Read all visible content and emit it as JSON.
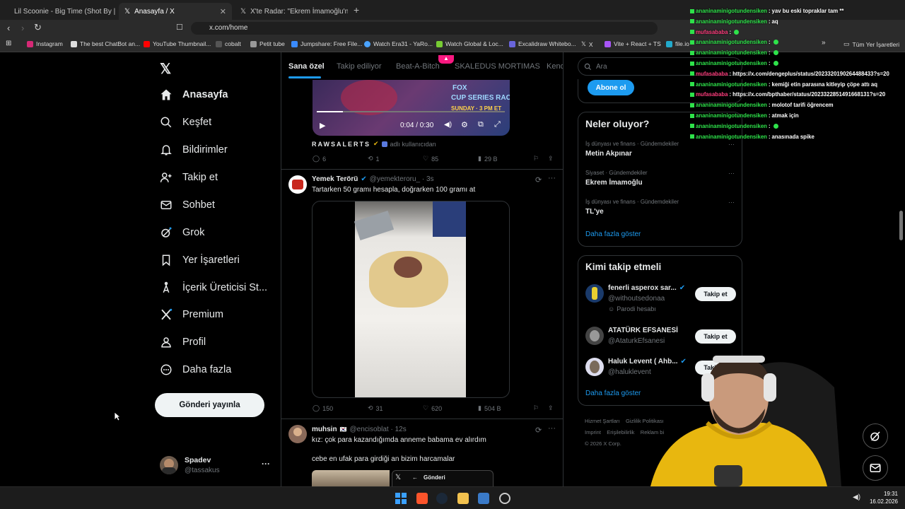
{
  "browser": {
    "tabs": [
      {
        "label": "Lil Scoonie - Big Time (Shot By | @ey"
      },
      {
        "label": "Anasayfa / X"
      },
      {
        "label": "X'te Radar: \"Ekrem İmamoğlu'nun bu"
      }
    ],
    "url": "x.com/home",
    "bookmarks": [
      "Instagram",
      "The best ChatBot an...",
      "YouTube Thumbnail...",
      "cobalt",
      "Petit tube",
      "Jumpshare: Free File...",
      "Watch Era31 - YaRo...",
      "Watch Global & Loc...",
      "Excalidraw Whitebo...",
      "X",
      "Vite + React + TS",
      "file.io",
      "Tüm Yer İşaretleri"
    ]
  },
  "nav": {
    "items": [
      "Anasayfa",
      "Keşfet",
      "Bildirimler",
      "Takip et",
      "Sohbet",
      "Grok",
      "Yer İşaretleri",
      "İçerik Üreticisi St...",
      "Premium",
      "Profil",
      "Daha fazla"
    ],
    "post_label": "Gönderi yayınla",
    "user_name": "Spadev",
    "user_handle": "@tassakus",
    "more": "···"
  },
  "feed": {
    "tabs": [
      "Sana özel",
      "Takip ediliyor",
      "Beat-A-Bitch",
      "SKALEDUS MORTIMAS",
      "Kend"
    ],
    "video": {
      "time": "0:04 / 0:30",
      "overlay1": "FOX",
      "overlay2": "CUP SERIES RACE",
      "overlay3": "SUNDAY · 3 PM ET"
    },
    "post0": {
      "author": "RAWSALERTS",
      "meta": "adlı kullanıcıdan",
      "replies": "6",
      "reposts": "1",
      "likes": "85",
      "views": "29 B"
    },
    "post1": {
      "name": "Yemek Terörü",
      "handle": "@yemekteroru_ · 3s",
      "text": "Tartarken 50 gramı hesapla, doğrarken 100 gramı at",
      "replies": "150",
      "reposts": "31",
      "likes": "620",
      "views": "504 B"
    },
    "post2": {
      "name": "muhsin",
      "handle": "@encisoblat · 12s",
      "text1": "kız: çok para kazandığımda anneme babama ev alırdım",
      "text2": "cebe en ufak para girdiği an bizim harcamalar",
      "embed_title": "Gönderi"
    }
  },
  "right": {
    "search_placeholder": "Ara",
    "subscribe": "Abone ol",
    "trends_title": "Neler oluyor?",
    "trends": [
      {
        "meta": "İş dünyası ve finans · Gündemdekiler",
        "name": "Metin Akpınar"
      },
      {
        "meta": "Siyaset · Gündemdekiler",
        "name": "Ekrem İmamoğlu"
      },
      {
        "meta": "İş dünyası ve finans · Gündemdekiler",
        "name": "TL'ye"
      }
    ],
    "show_more": "Daha fazla göster",
    "who_title": "Kimi takip etmeli",
    "who": [
      {
        "name": "fenerli asperox sar...",
        "handle": "@withoutsedonaa",
        "note": "Parodi hesabı",
        "btn": "Takip et"
      },
      {
        "name": "ATATÜRK EFSANESİ",
        "handle": "@AtaturkEfsanesi",
        "btn": "Takip et"
      },
      {
        "name": "Haluk Levent ( Ahb...",
        "handle": "@haluklevent",
        "btn": "Takip et"
      }
    ],
    "footer": [
      "Hizmet Şartları",
      "Gizlilik Politikası",
      "Imprint",
      "Erişilebilirlik",
      "Reklam bi",
      "© 2026 X Corp."
    ]
  },
  "chat": [
    {
      "user": "ananinaminigotundensiken",
      "msg": "yav bu eski topraklar tam **",
      "pink": false
    },
    {
      "user": "ananinaminigotundensiken",
      "msg": "aq",
      "pink": false
    },
    {
      "user": "mufasababa",
      "msg": "",
      "pink": true
    },
    {
      "user": "ananinaminigotundensiken",
      "msg": "",
      "pink": false
    },
    {
      "user": "ananinaminigotundensiken",
      "msg": "",
      "pink": false
    },
    {
      "user": "ananinaminigotundensiken",
      "msg": "",
      "pink": false
    },
    {
      "user": "mufasababa",
      "msg": "https://x.com/dengeplus/status/2023320190264488433?s=20",
      "pink": true
    },
    {
      "user": "ananinaminigotundensiken",
      "msg": "kemiği etin parasına kitleyip çöpe attı aq",
      "pink": false
    },
    {
      "user": "mufasababa",
      "msg": "https://x.com/bpthaber/status/2023322851491668131?s=20",
      "pink": true
    },
    {
      "user": "ananinaminigotundensiken",
      "msg": "molotof tarifi öğrencem",
      "pink": false
    },
    {
      "user": "ananinaminigotundensiken",
      "msg": "atmak için",
      "pink": false
    },
    {
      "user": "ananinaminigotundensiken",
      "msg": "",
      "pink": false
    },
    {
      "user": "ananinaminigotundensiken",
      "msg": "anasınada spike",
      "pink": false
    }
  ],
  "taskbar": {
    "time": "19:31",
    "date": "16.02.2026"
  },
  "colors": {
    "accent": "#1d9bf0",
    "chat_green": "#2ee24a",
    "chat_pink": "#ff3d7d",
    "hoodie": "#e8b70f"
  }
}
